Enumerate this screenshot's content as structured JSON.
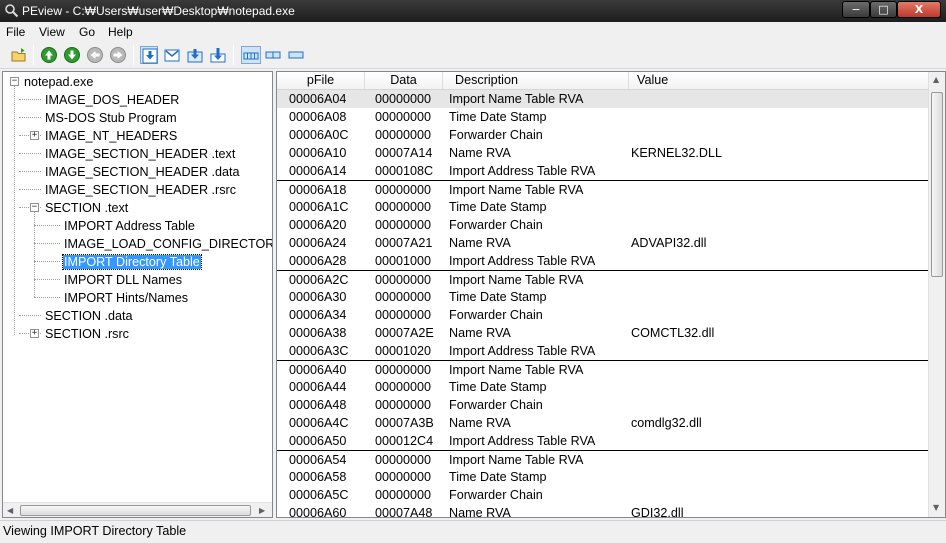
{
  "window": {
    "title": "PEview - C:₩Users₩user₩Desktop₩notepad.exe",
    "minimize_label": "−",
    "maximize_label": "□",
    "close_label": "X"
  },
  "menu": [
    "File",
    "View",
    "Go",
    "Help"
  ],
  "toolbar": {
    "buttons": [
      "open-icon",
      "up-icon",
      "down-icon",
      "back-icon",
      "forward-icon",
      "view-address-icon",
      "view-rva-icon",
      "view-file-offset-icon",
      "view-save-icon",
      "view-bytes-icon",
      "view-words-icon",
      "view-dwords-icon"
    ],
    "accent": "#1e6fc9",
    "nav_green": "#2f9a2f"
  },
  "tree": {
    "root": "notepad.exe",
    "items": [
      "IMAGE_DOS_HEADER",
      "MS-DOS Stub Program",
      "IMAGE_NT_HEADERS",
      "IMAGE_SECTION_HEADER .text",
      "IMAGE_SECTION_HEADER .data",
      "IMAGE_SECTION_HEADER .rsrc",
      "SECTION .text",
      "IMPORT Address Table",
      "IMAGE_LOAD_CONFIG_DIRECTORY",
      "IMPORT Directory Table",
      "IMPORT DLL Names",
      "IMPORT Hints/Names",
      "SECTION .data",
      "SECTION .rsrc"
    ],
    "selected": "IMPORT Directory Table",
    "expand_plus": "+",
    "expand_minus": "−"
  },
  "list": {
    "headers": [
      "pFile",
      "Data",
      "Description",
      "Value"
    ],
    "rows": [
      [
        "00006A04",
        "00000000",
        "Import Name Table RVA",
        ""
      ],
      [
        "00006A08",
        "00000000",
        "Time Date Stamp",
        ""
      ],
      [
        "00006A0C",
        "00000000",
        "Forwarder Chain",
        ""
      ],
      [
        "00006A10",
        "00007A14",
        "Name RVA",
        "KERNEL32.DLL"
      ],
      [
        "00006A14",
        "0000108C",
        "Import Address Table RVA",
        ""
      ],
      [
        "00006A18",
        "00000000",
        "Import Name Table RVA",
        ""
      ],
      [
        "00006A1C",
        "00000000",
        "Time Date Stamp",
        ""
      ],
      [
        "00006A20",
        "00000000",
        "Forwarder Chain",
        ""
      ],
      [
        "00006A24",
        "00007A21",
        "Name RVA",
        "ADVAPI32.dll"
      ],
      [
        "00006A28",
        "00001000",
        "Import Address Table RVA",
        ""
      ],
      [
        "00006A2C",
        "00000000",
        "Import Name Table RVA",
        ""
      ],
      [
        "00006A30",
        "00000000",
        "Time Date Stamp",
        ""
      ],
      [
        "00006A34",
        "00000000",
        "Forwarder Chain",
        ""
      ],
      [
        "00006A38",
        "00007A2E",
        "Name RVA",
        "COMCTL32.dll"
      ],
      [
        "00006A3C",
        "00001020",
        "Import Address Table RVA",
        ""
      ],
      [
        "00006A40",
        "00000000",
        "Import Name Table RVA",
        ""
      ],
      [
        "00006A44",
        "00000000",
        "Time Date Stamp",
        ""
      ],
      [
        "00006A48",
        "00000000",
        "Forwarder Chain",
        ""
      ],
      [
        "00006A4C",
        "00007A3B",
        "Name RVA",
        "comdlg32.dll"
      ],
      [
        "00006A50",
        "000012C4",
        "Import Address Table RVA",
        ""
      ],
      [
        "00006A54",
        "00000000",
        "Import Name Table RVA",
        ""
      ],
      [
        "00006A58",
        "00000000",
        "Time Date Stamp",
        ""
      ],
      [
        "00006A5C",
        "00000000",
        "Forwarder Chain",
        ""
      ],
      [
        "00006A60",
        "00007A48",
        "Name RVA",
        "GDI32.dll"
      ]
    ]
  },
  "status": "Viewing IMPORT Directory Table",
  "colors": {
    "selection": "#3399ff",
    "row_highlight": "#e6e6e6",
    "titlebar": "#2b2b2b"
  }
}
